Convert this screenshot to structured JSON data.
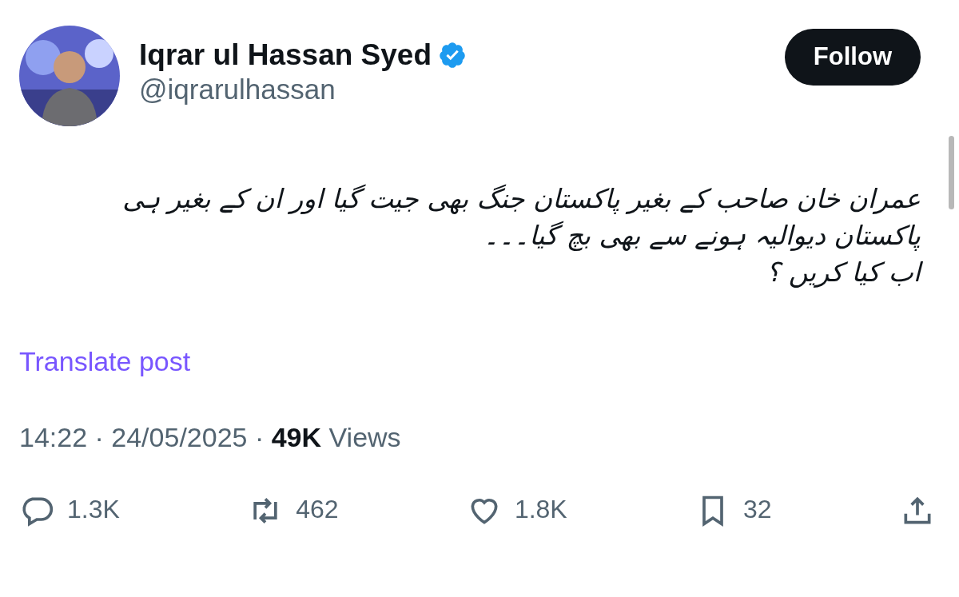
{
  "author": {
    "name": "Iqrar ul Hassan Syed",
    "verified": true,
    "handle": "@iqrarulhassan"
  },
  "follow_button": "Follow",
  "post_text": "عمران خان صاحب کے بغیر پاکستان جنگ بھی جیت گیا اور ان کے بغیر ہی پاکستان دیوالیہ ہونے سے بھی بچ گیا۔۔۔\nاب کیا کریں ؟",
  "translate_link": "Translate post",
  "meta": {
    "time": "14:22",
    "separator_1": "·",
    "date": "24/05/2025",
    "separator_2": "·",
    "views_count": "49K",
    "views_label": "Views"
  },
  "actions": [
    {
      "kind": "reply",
      "count": "1.3K"
    },
    {
      "kind": "repost",
      "count": "462"
    },
    {
      "kind": "like",
      "count": "1.8K"
    },
    {
      "kind": "bookmark",
      "count": "32"
    },
    {
      "kind": "share"
    }
  ]
}
